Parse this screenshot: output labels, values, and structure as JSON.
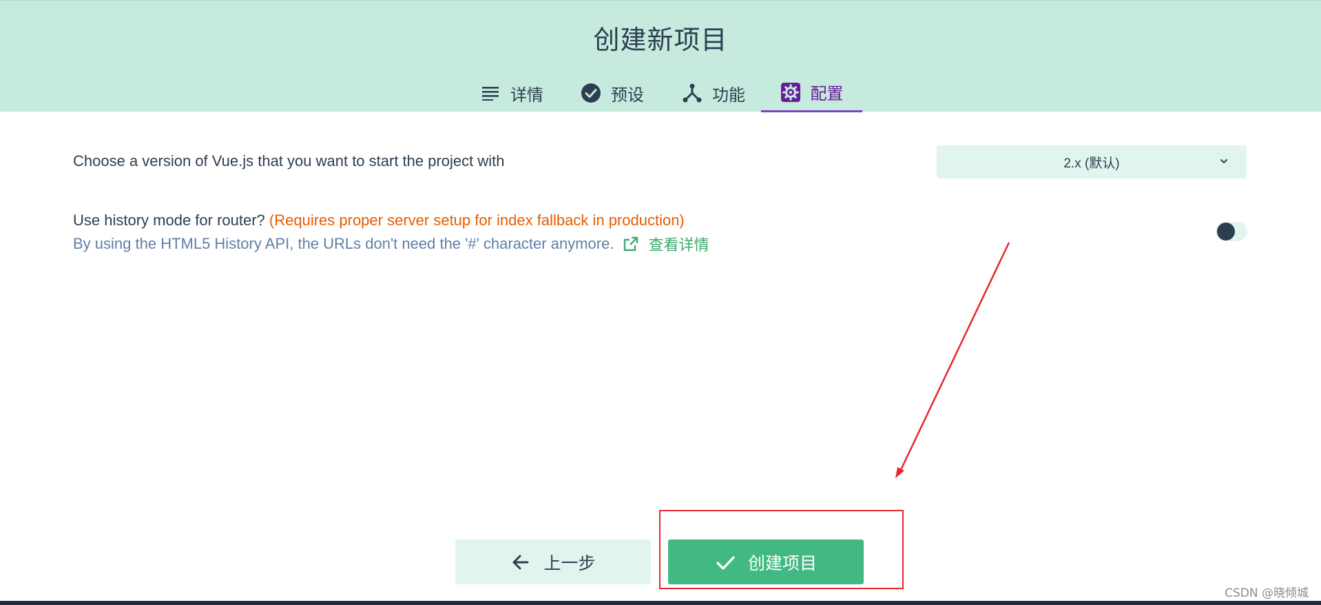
{
  "header": {
    "title": "创建新项目",
    "tabs": [
      {
        "label": "详情",
        "icon": "list-icon"
      },
      {
        "label": "预设",
        "icon": "check-circle-icon"
      },
      {
        "label": "功能",
        "icon": "fork-icon"
      },
      {
        "label": "配置",
        "icon": "gear-icon",
        "active": true
      }
    ]
  },
  "config": {
    "version_label": "Choose a version of Vue.js that you want to start the project with",
    "version_value": "2.x (默认)",
    "history_label": "Use history mode for router?",
    "history_warning": "(Requires proper server setup for index fallback in production)",
    "history_desc": "By using the HTML5 History API, the URLs don't need the '#' character anymore.",
    "more_info": "查看详情",
    "history_enabled": false
  },
  "actions": {
    "prev": "上一步",
    "create": "创建项目"
  },
  "colors": {
    "header_bg": "#c6ebde",
    "accent": "#42b983",
    "active_tab": "#6a1b9a",
    "warning": "#e65c00",
    "annotation": "#e8252d"
  },
  "watermark": "CSDN @晓倾城"
}
